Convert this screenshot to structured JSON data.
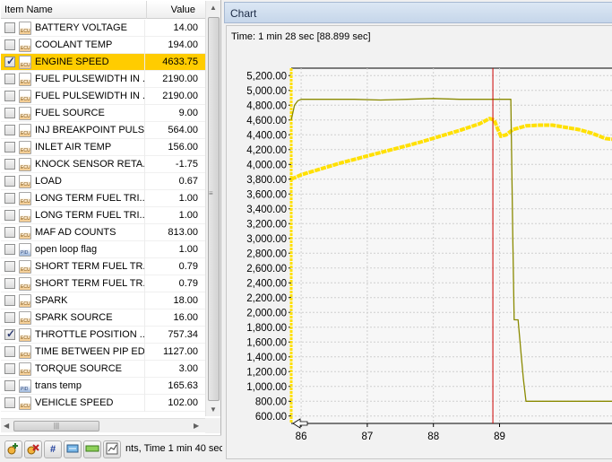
{
  "list": {
    "col_name": "Item Name",
    "col_value": "Value",
    "items": [
      {
        "name": "BATTERY VOLTAGE",
        "value": "14.00",
        "checked": false,
        "icon": "orange-gauge-icon"
      },
      {
        "name": "COOLANT TEMP",
        "value": "194.00",
        "checked": false,
        "icon": "orange-gauge-icon"
      },
      {
        "name": "ENGINE SPEED",
        "value": "4633.75",
        "checked": true,
        "icon": "orange-gauge-icon",
        "selected": true
      },
      {
        "name": "FUEL PULSEWIDTH IN ...",
        "value": "2190.00",
        "checked": false,
        "icon": "orange-gauge-icon"
      },
      {
        "name": "FUEL PULSEWIDTH IN ...",
        "value": "2190.00",
        "checked": false,
        "icon": "orange-gauge-icon"
      },
      {
        "name": "FUEL SOURCE",
        "value": "9.00",
        "checked": false,
        "icon": "orange-gauge-icon"
      },
      {
        "name": "INJ BREAKPOINT PULS...",
        "value": "564.00",
        "checked": false,
        "icon": "orange-gauge-icon"
      },
      {
        "name": "INLET AIR TEMP",
        "value": "156.00",
        "checked": false,
        "icon": "orange-gauge-icon"
      },
      {
        "name": "KNOCK SENSOR RETA...",
        "value": "-1.75",
        "checked": false,
        "icon": "orange-gauge-icon"
      },
      {
        "name": "LOAD",
        "value": "0.67",
        "checked": false,
        "icon": "orange-gauge-icon"
      },
      {
        "name": "LONG TERM FUEL TRI...",
        "value": "1.00",
        "checked": false,
        "icon": "orange-gauge-icon"
      },
      {
        "name": "LONG TERM FUEL TRI...",
        "value": "1.00",
        "checked": false,
        "icon": "orange-gauge-icon"
      },
      {
        "name": "MAF AD COUNTS",
        "value": "813.00",
        "checked": false,
        "icon": "orange-gauge-icon"
      },
      {
        "name": "open loop flag",
        "value": "1.00",
        "checked": false,
        "icon": "blue-pid-icon"
      },
      {
        "name": "SHORT TERM FUEL TR...",
        "value": "0.79",
        "checked": false,
        "icon": "orange-gauge-icon"
      },
      {
        "name": "SHORT TERM FUEL TR...",
        "value": "0.79",
        "checked": false,
        "icon": "orange-gauge-icon"
      },
      {
        "name": "SPARK",
        "value": "18.00",
        "checked": false,
        "icon": "orange-gauge-icon"
      },
      {
        "name": "SPARK SOURCE",
        "value": "16.00",
        "checked": false,
        "icon": "orange-gauge-icon"
      },
      {
        "name": "THROTTLE POSITION ...",
        "value": "757.34",
        "checked": true,
        "icon": "orange-gauge-icon"
      },
      {
        "name": "TIME BETWEEN PIP ED...",
        "value": "1127.00",
        "checked": false,
        "icon": "orange-gauge-icon"
      },
      {
        "name": "TORQUE SOURCE",
        "value": "3.00",
        "checked": false,
        "icon": "orange-gauge-icon"
      },
      {
        "name": "trans temp",
        "value": "165.63",
        "checked": false,
        "icon": "blue-pid-icon"
      },
      {
        "name": "VEHICLE SPEED",
        "value": "102.00",
        "checked": false,
        "icon": "orange-gauge-icon"
      }
    ]
  },
  "toolbar": {
    "status_text": "nts, Time 1 min 40 sec",
    "buttons": [
      "add-item-icon",
      "remove-item-icon",
      "hash-icon",
      "fit-view-icon",
      "bar-icon",
      "chart-settings-icon"
    ],
    "hash_label": "#"
  },
  "chart_panel": {
    "title": "Chart",
    "time_label": "Time: 1 min 28 sec [88.899 sec]"
  },
  "chart_data": {
    "type": "line",
    "x_ticks": [
      "86",
      "87",
      "88",
      "89"
    ],
    "y_ticks": [
      "5,200.00",
      "5,000.00",
      "4,800.00",
      "4,600.00",
      "4,400.00",
      "4,200.00",
      "4,000.00",
      "3,800.00",
      "3,600.00",
      "3,400.00",
      "3,200.00",
      "3,000.00",
      "2,800.00",
      "2,600.00",
      "2,400.00",
      "2,200.00",
      "2,000.00",
      "1,800.00",
      "1,600.00",
      "1,400.00",
      "1,200.00",
      "1,000.00",
      "800.00",
      "600.00"
    ],
    "ylim": [
      500,
      5300
    ],
    "xlim": [
      85.85,
      90.7
    ],
    "cursor_x": 88.899,
    "grid": true,
    "colors": {
      "engine_speed": "#ffe000",
      "throttle_position": "#8a8a00",
      "cursor": "#cc0000"
    },
    "series": [
      {
        "values_x": [
          85.85,
          86.0,
          86.3,
          86.6,
          86.9,
          87.2,
          87.5,
          87.8,
          88.1,
          88.4,
          88.7,
          88.85,
          88.92,
          88.97,
          89.02,
          89.1,
          89.2,
          89.4,
          89.6,
          89.8,
          90.0,
          90.2,
          90.4,
          90.6,
          90.7
        ],
        "values_y": [
          3800,
          3860,
          3940,
          4020,
          4090,
          4160,
          4230,
          4300,
          4380,
          4460,
          4550,
          4620,
          4600,
          4480,
          4380,
          4400,
          4470,
          4520,
          4530,
          4530,
          4500,
          4470,
          4420,
          4350,
          4340
        ]
      },
      {
        "values_x": [
          85.85,
          85.9,
          85.95,
          86.0,
          86.4,
          86.8,
          87.2,
          87.6,
          88.0,
          88.4,
          88.8,
          89.0,
          89.17,
          89.2,
          89.22,
          89.28,
          89.32,
          89.36,
          89.4,
          89.6,
          90.0,
          90.4,
          90.7
        ],
        "values_y": [
          4600,
          4800,
          4860,
          4880,
          4880,
          4880,
          4870,
          4880,
          4890,
          4880,
          4880,
          4880,
          4880,
          3000,
          1900,
          1900,
          1500,
          1100,
          800,
          800,
          800,
          800,
          800
        ]
      }
    ]
  }
}
